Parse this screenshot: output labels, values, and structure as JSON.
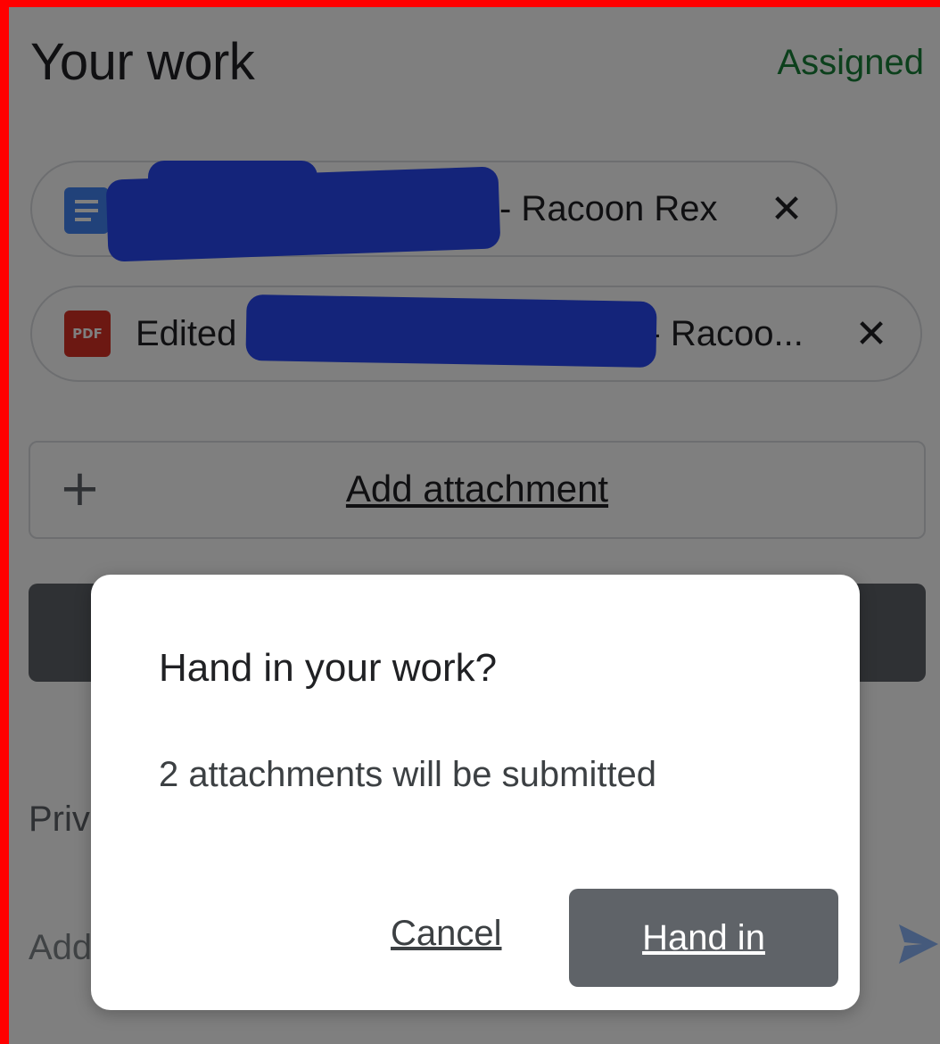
{
  "header": {
    "title": "Your work",
    "status": "Assigned"
  },
  "attachments": [
    {
      "type": "doc",
      "icon": "google-docs-icon",
      "label": "- Racoon Rex",
      "remove_icon": "close-icon"
    },
    {
      "type": "pdf",
      "icon": "pdf-icon",
      "icon_text": "PDF",
      "label": "Edited",
      "label_end": "- Racoo...",
      "remove_icon": "close-icon"
    }
  ],
  "add_attachment": {
    "icon": "plus-icon",
    "label": "Add attachment"
  },
  "private_comments": {
    "label": "Priv",
    "placeholder": "Add",
    "send_icon": "send-icon"
  },
  "dialog": {
    "title": "Hand in your work?",
    "body": "2 attachments will be submitted",
    "cancel_label": "Cancel",
    "confirm_label": "Hand in"
  },
  "colors": {
    "status_green": "#188038",
    "redaction_blue": "#2849f5",
    "doc_blue": "#4285f4",
    "pdf_red": "#d93025",
    "button_gray": "#5f6368"
  }
}
